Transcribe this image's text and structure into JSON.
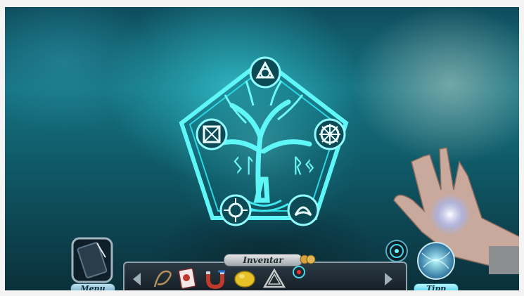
{
  "hud": {
    "inventory_label": "Inventar",
    "menu_label": "Menu",
    "hint_label": "Tipp"
  },
  "inventory_items": [
    {
      "name": "rope-item"
    },
    {
      "name": "card-item"
    },
    {
      "name": "magnet-item"
    },
    {
      "name": "lemon-item"
    },
    {
      "name": "celtic-triangle-item"
    }
  ],
  "colors": {
    "glow": "#4ff3f6",
    "glow_dark": "#0a6f7d",
    "button_teal": "#37c9e6"
  }
}
